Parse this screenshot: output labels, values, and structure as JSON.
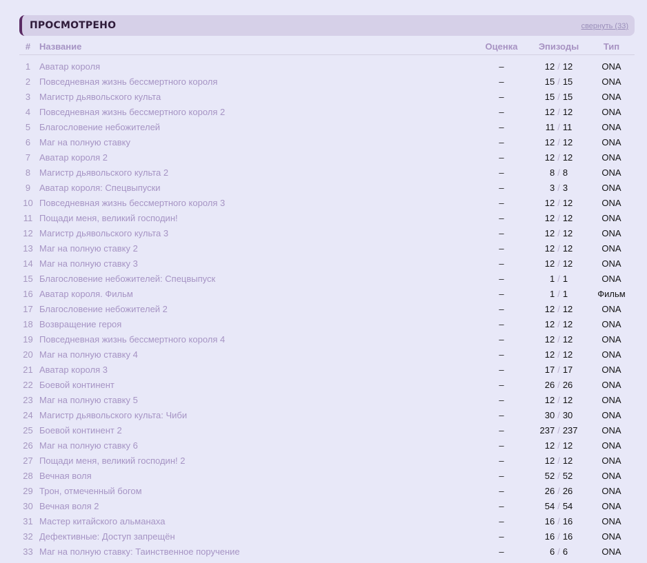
{
  "section": {
    "title": "ПРОСМОТРЕНО",
    "collapse_label": "свернуть (33)"
  },
  "table": {
    "headers": {
      "num": "#",
      "title": "Название",
      "score": "Оценка",
      "episodes": "Эпизоды",
      "type": "Тип"
    },
    "rows": [
      {
        "num": "1",
        "title": "Аватар короля",
        "score": "–",
        "watched": "12",
        "total": "12",
        "type": "ONA"
      },
      {
        "num": "2",
        "title": "Повседневная жизнь бессмертного короля",
        "score": "–",
        "watched": "15",
        "total": "15",
        "type": "ONA"
      },
      {
        "num": "3",
        "title": "Магистр дьявольского культа",
        "score": "–",
        "watched": "15",
        "total": "15",
        "type": "ONA"
      },
      {
        "num": "4",
        "title": "Повседневная жизнь бессмертного короля 2",
        "score": "–",
        "watched": "12",
        "total": "12",
        "type": "ONA"
      },
      {
        "num": "5",
        "title": "Благословение небожителей",
        "score": "–",
        "watched": "11",
        "total": "11",
        "type": "ONA"
      },
      {
        "num": "6",
        "title": "Маг на полную ставку",
        "score": "–",
        "watched": "12",
        "total": "12",
        "type": "ONA"
      },
      {
        "num": "7",
        "title": "Аватар короля 2",
        "score": "–",
        "watched": "12",
        "total": "12",
        "type": "ONA"
      },
      {
        "num": "8",
        "title": "Магистр дьявольского культа 2",
        "score": "–",
        "watched": "8",
        "total": "8",
        "type": "ONA"
      },
      {
        "num": "9",
        "title": "Аватар короля: Спецвыпуски",
        "score": "–",
        "watched": "3",
        "total": "3",
        "type": "ONA"
      },
      {
        "num": "10",
        "title": "Повседневная жизнь бессмертного короля 3",
        "score": "–",
        "watched": "12",
        "total": "12",
        "type": "ONA"
      },
      {
        "num": "11",
        "title": "Пощади меня, великий господин!",
        "score": "–",
        "watched": "12",
        "total": "12",
        "type": "ONA"
      },
      {
        "num": "12",
        "title": "Магистр дьявольского культа 3",
        "score": "–",
        "watched": "12",
        "total": "12",
        "type": "ONA"
      },
      {
        "num": "13",
        "title": "Маг на полную ставку 2",
        "score": "–",
        "watched": "12",
        "total": "12",
        "type": "ONA"
      },
      {
        "num": "14",
        "title": "Маг на полную ставку 3",
        "score": "–",
        "watched": "12",
        "total": "12",
        "type": "ONA"
      },
      {
        "num": "15",
        "title": "Благословение небожителей: Спецвыпуск",
        "score": "–",
        "watched": "1",
        "total": "1",
        "type": "ONA"
      },
      {
        "num": "16",
        "title": "Аватар короля. Фильм",
        "score": "–",
        "watched": "1",
        "total": "1",
        "type": "Фильм"
      },
      {
        "num": "17",
        "title": "Благословение небожителей 2",
        "score": "–",
        "watched": "12",
        "total": "12",
        "type": "ONA"
      },
      {
        "num": "18",
        "title": "Возвращение героя",
        "score": "–",
        "watched": "12",
        "total": "12",
        "type": "ONA"
      },
      {
        "num": "19",
        "title": "Повседневная жизнь бессмертного короля 4",
        "score": "–",
        "watched": "12",
        "total": "12",
        "type": "ONA"
      },
      {
        "num": "20",
        "title": "Маг на полную ставку 4",
        "score": "–",
        "watched": "12",
        "total": "12",
        "type": "ONA"
      },
      {
        "num": "21",
        "title": "Аватар короля 3",
        "score": "–",
        "watched": "17",
        "total": "17",
        "type": "ONA"
      },
      {
        "num": "22",
        "title": "Боевой континент",
        "score": "–",
        "watched": "26",
        "total": "26",
        "type": "ONA"
      },
      {
        "num": "23",
        "title": "Маг на полную ставку 5",
        "score": "–",
        "watched": "12",
        "total": "12",
        "type": "ONA"
      },
      {
        "num": "24",
        "title": "Магистр дьявольского культа: Чиби",
        "score": "–",
        "watched": "30",
        "total": "30",
        "type": "ONA"
      },
      {
        "num": "25",
        "title": "Боевой континент 2",
        "score": "–",
        "watched": "237",
        "total": "237",
        "type": "ONA"
      },
      {
        "num": "26",
        "title": "Маг на полную ставку 6",
        "score": "–",
        "watched": "12",
        "total": "12",
        "type": "ONA"
      },
      {
        "num": "27",
        "title": "Пощади меня, великий господин! 2",
        "score": "–",
        "watched": "12",
        "total": "12",
        "type": "ONA"
      },
      {
        "num": "28",
        "title": "Вечная воля",
        "score": "–",
        "watched": "52",
        "total": "52",
        "type": "ONA"
      },
      {
        "num": "29",
        "title": "Трон, отмеченный богом",
        "score": "–",
        "watched": "26",
        "total": "26",
        "type": "ONA"
      },
      {
        "num": "30",
        "title": "Вечная воля 2",
        "score": "–",
        "watched": "54",
        "total": "54",
        "type": "ONA"
      },
      {
        "num": "31",
        "title": "Мастер китайского альманаха",
        "score": "–",
        "watched": "16",
        "total": "16",
        "type": "ONA"
      },
      {
        "num": "32",
        "title": "Дефективные: Доступ запрещён",
        "score": "–",
        "watched": "16",
        "total": "16",
        "type": "ONA"
      },
      {
        "num": "33",
        "title": "Маг на полную ставку: Таинственное поручение",
        "score": "–",
        "watched": "6",
        "total": "6",
        "type": "ONA"
      }
    ],
    "episode_separator": "/"
  }
}
